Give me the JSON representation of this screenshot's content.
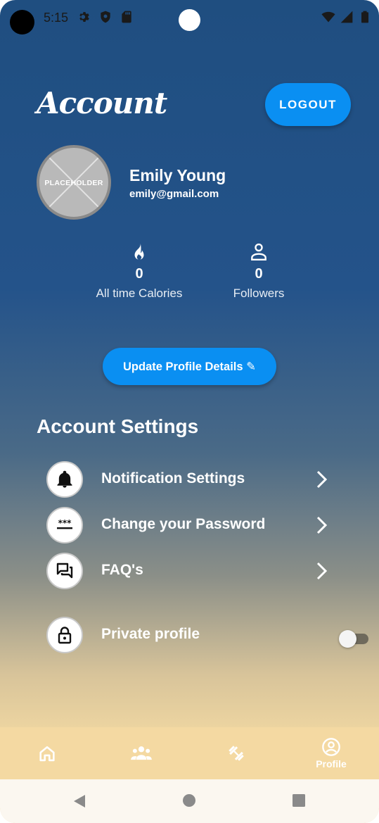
{
  "status_bar": {
    "time": "5:15",
    "icons_left": [
      "gear-icon",
      "shield-icon",
      "sd-card-icon"
    ],
    "icons_right": [
      "wifi-icon",
      "signal-icon",
      "battery-icon"
    ]
  },
  "header": {
    "title": "Account",
    "logout_label": "LOGOUT"
  },
  "profile": {
    "avatar_text": "PLACEHOLDER",
    "name": "Emily Young",
    "email": "emily@gmail.com"
  },
  "stats": [
    {
      "icon": "flame-icon",
      "value": "0",
      "label": "All time Calories"
    },
    {
      "icon": "person-icon",
      "value": "0",
      "label": "Followers"
    }
  ],
  "update_button_label": "Update Profile Details ✎",
  "settings": {
    "heading": "Account Settings",
    "items": [
      {
        "icon": "bell-icon",
        "label": "Notification Settings"
      },
      {
        "icon": "password-icon",
        "label": "Change your Password"
      },
      {
        "icon": "chat-icon",
        "label": "FAQ's"
      }
    ],
    "private_profile": {
      "icon": "lock-icon",
      "label": "Private profile",
      "enabled": false
    }
  },
  "bottom_nav": {
    "items": [
      {
        "icon": "home-icon",
        "label": ""
      },
      {
        "icon": "group-icon",
        "label": ""
      },
      {
        "icon": "dumbbell-icon",
        "label": ""
      },
      {
        "icon": "profile-icon",
        "label": "Profile",
        "active": true
      }
    ]
  },
  "system_nav": [
    "back-icon",
    "home-circle-icon",
    "recents-icon"
  ],
  "colors": {
    "accent": "#0a8ff2",
    "gradient_top": "#1f4e80",
    "gradient_bottom": "#f3d9a3",
    "nav_background": "#f4d9a2"
  }
}
